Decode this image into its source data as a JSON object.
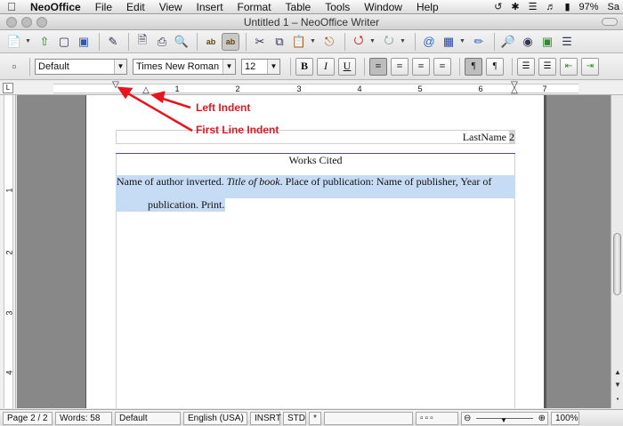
{
  "menubar": {
    "apple_icon": "apple-logo",
    "items": [
      "NeoOffice",
      "File",
      "Edit",
      "View",
      "Insert",
      "Format",
      "Table",
      "Tools",
      "Window",
      "Help"
    ],
    "battery": "97%",
    "user_initials": "Sa"
  },
  "window": {
    "title": "Untitled 1 – NeoOffice Writer"
  },
  "format_toolbar": {
    "paragraph_style": "Default",
    "font_name": "Times New Roman",
    "font_size": "12",
    "bold": "B",
    "italic": "I",
    "underline": "U"
  },
  "ruler": {
    "numbers": [
      "1",
      "2",
      "3",
      "4",
      "5",
      "6",
      "7"
    ],
    "vertical_numbers": [
      "1",
      "2",
      "3",
      "4"
    ]
  },
  "document": {
    "header_text": "LastName",
    "header_page_number": "2",
    "heading": "Works Cited",
    "entry_part1": "Name of author inverted. ",
    "entry_title": "Title of book",
    "entry_part2": ". Place of publication: Name of publisher, Year of",
    "entry_line2": "publication. Print."
  },
  "annotations": {
    "left_indent": "Left Indent",
    "first_line_indent": "First Line Indent",
    "color": "#e8151f"
  },
  "statusbar": {
    "page": "Page 2 / 2",
    "words": "Words: 58",
    "style": "Default",
    "language": "English (USA)",
    "insert_mode": "INSRT",
    "selection_mode": "STD",
    "modified": "*",
    "zoom": "100%"
  }
}
